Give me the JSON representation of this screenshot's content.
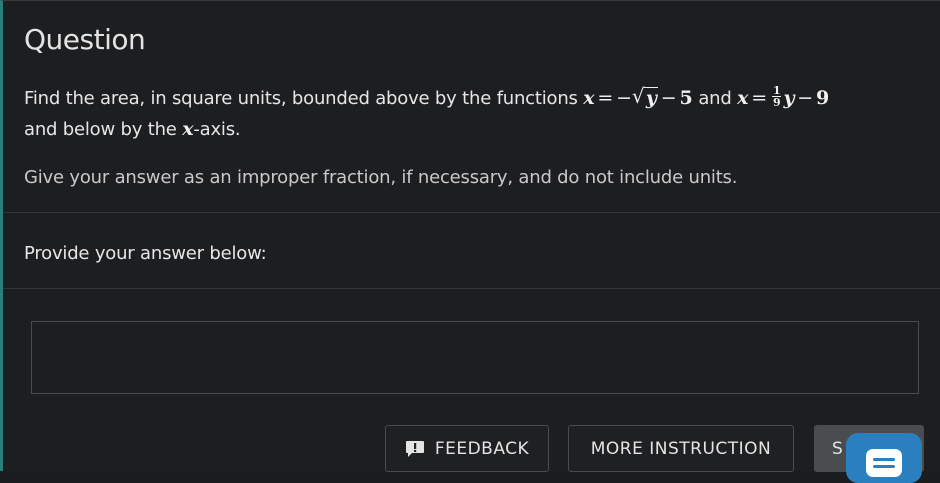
{
  "question": {
    "title": "Question",
    "line1_prefix": "Find the area, in square units, bounded above by the functions",
    "f1_lhs": "x",
    "f1_eq": "=",
    "f1_neg": "−",
    "f1_radical": "√",
    "f1_radicand": "y",
    "f1_minus": "−",
    "f1_const": "5",
    "and_word": "and",
    "f2_lhs": "x",
    "f2_eq": "=",
    "f2_frac_num": "1",
    "f2_frac_den": "9",
    "f2_var": "y",
    "f2_minus": "−",
    "f2_const": "9",
    "line2_prefix": "and below by the",
    "line2_var": "x",
    "line2_suffix": "-axis.",
    "hint": "Give your answer as an improper fraction, if necessary, and do not include units."
  },
  "answer": {
    "prompt": "Provide your answer below:",
    "value": "",
    "placeholder": ""
  },
  "buttons": {
    "feedback_label": "FEEDBACK",
    "feedback_icon": "comment-exclamation-icon",
    "more_label": "MORE INSTRUCTION",
    "submit_label": "S"
  },
  "chat": {
    "icon": "chat-icon"
  },
  "colors": {
    "background": "#1d1e20",
    "accent_border": "#2b7f7a",
    "chat_button": "#2a7fbf",
    "submit_button": "#4a4c50"
  }
}
